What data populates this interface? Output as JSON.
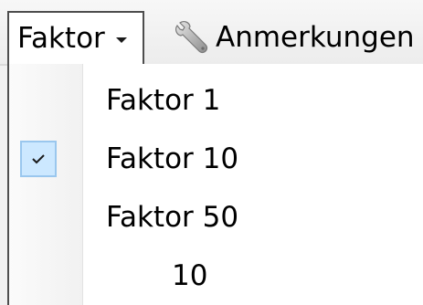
{
  "toolbar": {
    "faktor_label": "Faktor",
    "faktor_arrow_icon": "chevron-down-icon",
    "anmerkungen_label": "Anmerkungen",
    "anmerkungen_icon": "wrench-icon"
  },
  "menu": {
    "items": [
      {
        "label": "Faktor 1",
        "checked": false
      },
      {
        "label": "Faktor 10",
        "checked": true
      },
      {
        "label": "Faktor 50",
        "checked": false
      }
    ],
    "custom_value": "10"
  },
  "colors": {
    "check_highlight": "#cce8ff",
    "check_border": "#9ac7ee"
  }
}
